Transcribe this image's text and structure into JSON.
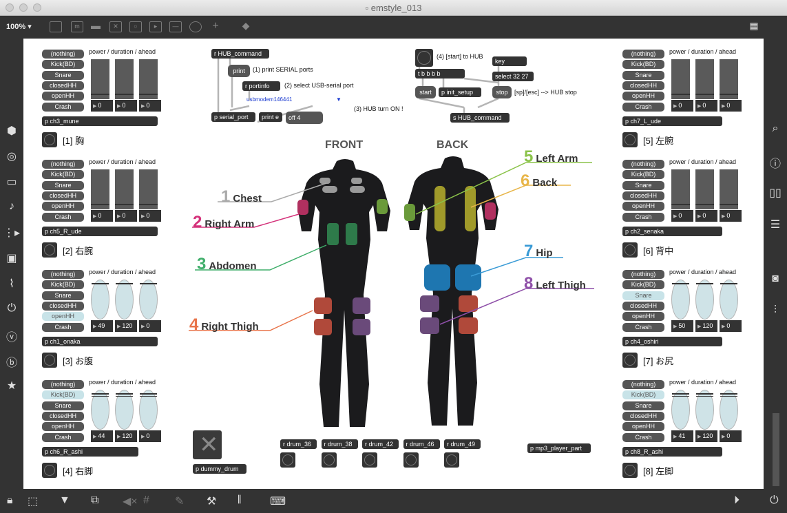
{
  "window": {
    "title": "emstyle_013",
    "zoom": "100%"
  },
  "bank": {
    "heading": "power / duration / ahead",
    "drums": [
      "(nothing)",
      "Kick(BD)",
      "Snare",
      "closedHH",
      "openHH",
      "Crash"
    ]
  },
  "channels": [
    {
      "obj": "p ch3_mune",
      "label": "[1] 胸",
      "vals": [
        "0",
        "0",
        "0"
      ],
      "hl": -1,
      "light": false
    },
    {
      "obj": "p ch5_R_ude",
      "label": "[2] 右腕",
      "vals": [
        "0",
        "0",
        "0"
      ],
      "hl": -1,
      "light": false
    },
    {
      "obj": "p ch1_onaka",
      "label": "[3] お腹",
      "vals": [
        "49",
        "120",
        "0"
      ],
      "hl": 4,
      "light": true
    },
    {
      "obj": "p ch6_R_ashi",
      "label": "[4] 右脚",
      "vals": [
        "44",
        "120",
        "0"
      ],
      "hl": 1,
      "light": true
    },
    {
      "obj": "p ch7_L_ude",
      "label": "[5] 左腕",
      "vals": [
        "0",
        "0",
        "0"
      ],
      "hl": -1,
      "light": false
    },
    {
      "obj": "p ch2_senaka",
      "label": "[6] 背中",
      "vals": [
        "0",
        "0",
        "0"
      ],
      "hl": -1,
      "light": false
    },
    {
      "obj": "p ch4_oshiri",
      "label": "[7] お尻",
      "vals": [
        "50",
        "120",
        "0"
      ],
      "hl": 2,
      "light": true
    },
    {
      "obj": "p ch8_R_ashi",
      "label": "[8] 左脚",
      "vals": [
        "41",
        "120",
        "0"
      ],
      "hl": 1,
      "light": true
    }
  ],
  "hub": {
    "r_cmd": "r HUB_command",
    "print": "print",
    "c1": "(1) print SERIAL ports",
    "portinfo": "r portinfo",
    "c2": "(2) select USB-serial port",
    "menu": "usbmodem146441",
    "serial": "p serial_port",
    "printe": "print e",
    "off": "off 4",
    "c3": "(3) HUB turn ON !",
    "c4": "(4) [start] to HUB",
    "key": "key",
    "tbbbb": "t b b b b",
    "select": "select 32 27",
    "start": "start",
    "init": "p init_setup",
    "stop": "stop",
    "cstop": "[sp]/[esc] --> HUB stop",
    "s_cmd": "s HUB_command"
  },
  "suit": {
    "front": "FRONT",
    "back": "BACK",
    "labels": [
      {
        "n": "1",
        "t": "Chest",
        "color": "#aaaaaa"
      },
      {
        "n": "2",
        "t": "Right Arm",
        "color": "#d4317a"
      },
      {
        "n": "3",
        "t": "Abdomen",
        "color": "#3fae6a"
      },
      {
        "n": "4",
        "t": "Right Thigh",
        "color": "#e8744a"
      },
      {
        "n": "5",
        "t": "Left Arm",
        "color": "#8bc34a"
      },
      {
        "n": "6",
        "t": "Back",
        "color": "#e8b64a"
      },
      {
        "n": "7",
        "t": "Hip",
        "color": "#3a9bd6"
      },
      {
        "n": "8",
        "t": "Left Thigh",
        "color": "#8e4fa8"
      }
    ]
  },
  "drums": [
    "r drum_36",
    "r drum_38",
    "r drum_42",
    "r drum_46",
    "r drum_49"
  ],
  "dummy": "p dummy_drum",
  "mp3": "p mp3_player_part"
}
